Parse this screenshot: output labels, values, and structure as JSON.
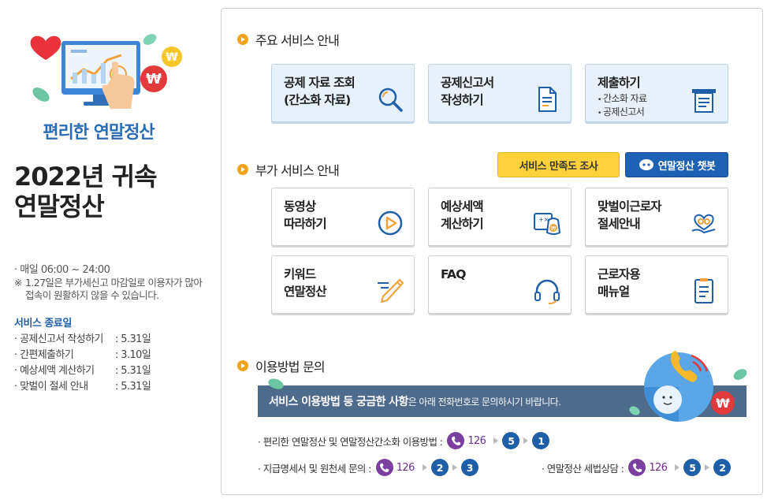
{
  "sidebar": {
    "brand": "편리한 연말정산",
    "title_line1": "2022년 귀속",
    "title_line2": "연말정산",
    "hours": "· 매일 06:00  ~ 24:00",
    "notice_mark": "※",
    "notice_text": "1.27일은 부가세신고 마감일로 이용자가 많아 접속이 원활하지 않을 수 있습니다.",
    "end_title": "서비스 종료일",
    "end_items": [
      {
        "name": "· 공제신고서 작성하기",
        "date": ": 5.31일"
      },
      {
        "name": "· 간편제출하기",
        "date": ": 3.10일"
      },
      {
        "name": "· 예상세액 계산하기",
        "date": ": 5.31일"
      },
      {
        "name": "· 맞벌이 절세 안내",
        "date": ": 5.31일"
      }
    ]
  },
  "main_services": {
    "title": "주요 서비스 안내",
    "cards": [
      {
        "label": "공제 자료 조회\n(간소화 자료)",
        "icon": "magnifier-icon"
      },
      {
        "label": "공제신고서\n작성하기",
        "icon": "document-edit-icon"
      },
      {
        "label": "제출하기",
        "icon": "document-submit-icon",
        "sub": [
          "간소화 자료",
          "공제신고서"
        ]
      }
    ]
  },
  "extra_services": {
    "title": "부가 서비스 안내",
    "survey_button": "서비스 만족도 조사",
    "chatbot_button": "연말정산 챗봇",
    "cards": [
      {
        "label": "동영상\n따라하기",
        "icon": "play-icon"
      },
      {
        "label": "예상세액\n계산하기",
        "icon": "calculator-money-icon"
      },
      {
        "label": "맞벌이근로자\n절세안내",
        "icon": "heart-hand-icon"
      },
      {
        "label": "키워드\n연말정산",
        "icon": "pencil-icon"
      },
      {
        "label": "FAQ",
        "icon": "headset-icon"
      },
      {
        "label": "근로자용\n매뉴얼",
        "icon": "manual-icon"
      }
    ]
  },
  "inquiry": {
    "title": "이용방법 문의",
    "banner_bold": "서비스 이용방법 등 궁금한 사항",
    "banner_rest": "은 아래 전화번호로 문의하시기 바랍니다.",
    "rows": [
      {
        "name": "· 편리한 연말정산 및 연말정산간소화 이용방법 :",
        "number": "126",
        "steps": [
          "5",
          "1"
        ]
      },
      {
        "name": "· 지급명세서  및 원천세 문의 :",
        "number": "126",
        "steps": [
          "2",
          "3"
        ]
      },
      {
        "name": "· 연말정산 세법상담  :",
        "number": "126",
        "steps": [
          "5",
          "2"
        ]
      }
    ]
  },
  "colors": {
    "accent_blue": "#1f5fa8",
    "bullet_orange": "#f5a21b",
    "survey_yellow": "#ffd23c",
    "chatbot_blue": "#1d61b3",
    "banner_slate": "#4e6b8b",
    "phone_purple": "#7b3fa0"
  }
}
